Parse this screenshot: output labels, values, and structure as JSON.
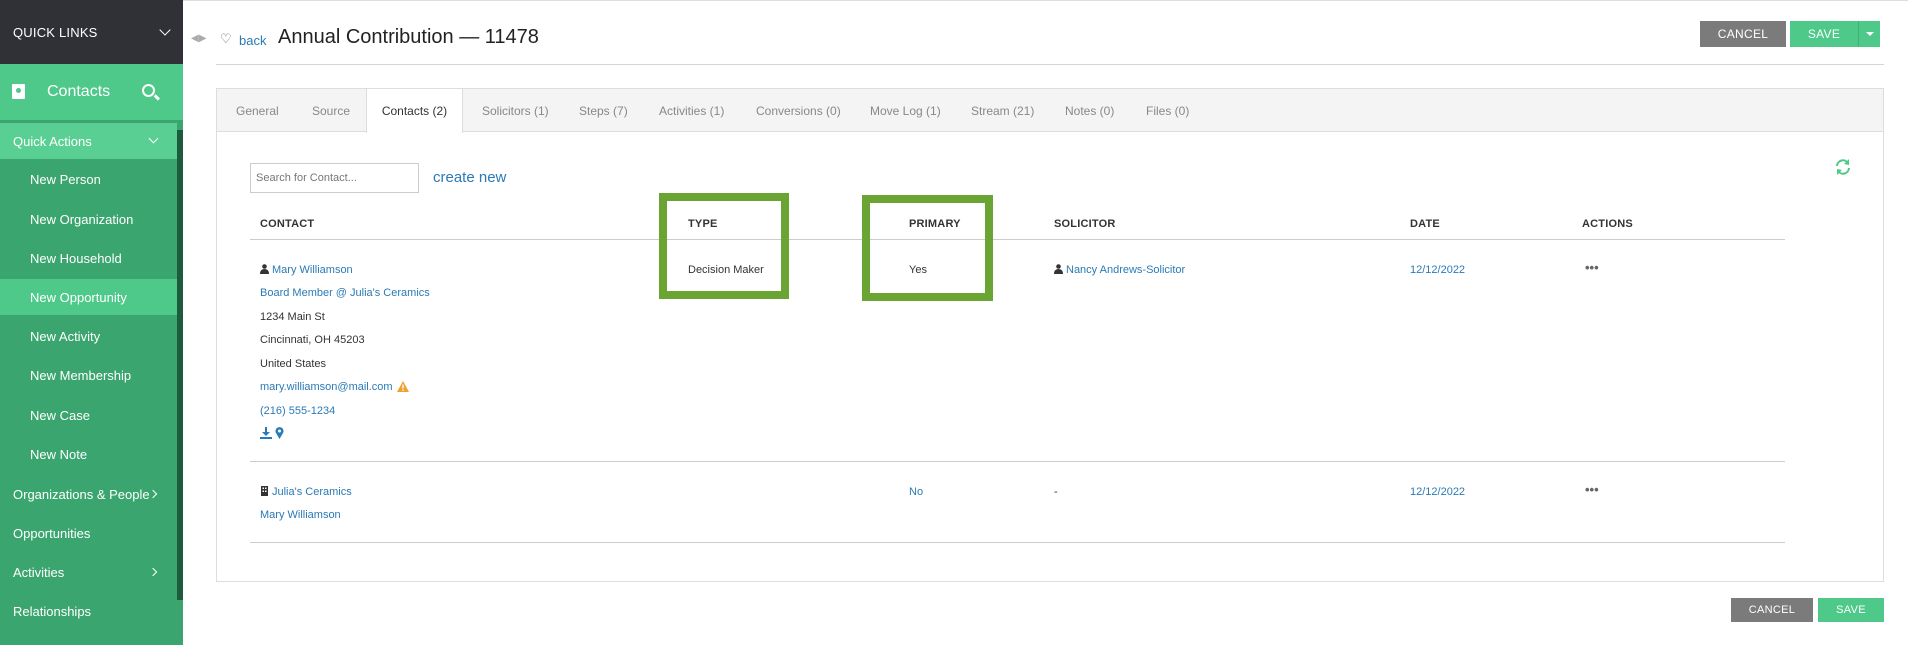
{
  "sidebar": {
    "quick_links": "QUICK LINKS",
    "module_title": "Contacts",
    "quick_actions": "Quick Actions",
    "sub_items": [
      "New Person",
      "New Organization",
      "New Household",
      "New Opportunity",
      "New Activity",
      "New Membership",
      "New Case",
      "New Note"
    ],
    "active_sub_item": "New Opportunity",
    "main_items": [
      "Organizations & People",
      "Opportunities",
      "Activities",
      "Relationships"
    ]
  },
  "header": {
    "back_label": "back",
    "title": "Annual Contribution — 11478",
    "cancel_label": "CANCEL",
    "save_label": "SAVE"
  },
  "tabs": [
    "General",
    "Source",
    "Contacts (2)",
    "Solicitors (1)",
    "Steps (7)",
    "Activities (1)",
    "Conversions (0)",
    "Move Log (1)",
    "Stream (21)",
    "Notes (0)",
    "Files (0)"
  ],
  "active_tab": "Contacts (2)",
  "contacts": {
    "search_placeholder": "Search for Contact...",
    "create_new": "create new",
    "columns": {
      "contact": "CONTACT",
      "type": "TYPE",
      "primary": "PRIMARY",
      "solicitor": "SOLICITOR",
      "date": "DATE",
      "actions": "ACTIONS"
    },
    "rows": [
      {
        "name": "Mary Williamson",
        "role": "Board Member @ Julia's Ceramics",
        "address1": "1234 Main St",
        "address2": "Cincinnati, OH 45203",
        "country": "United States",
        "email": "mary.williamson@mail.com",
        "phone": "(216) 555-1234",
        "type": "Decision Maker",
        "primary": "Yes",
        "solicitor": "Nancy Andrews-Solicitor",
        "date": "12/12/2022",
        "actions": "•••"
      },
      {
        "name": "Julia's Ceramics",
        "sub": "Mary Williamson",
        "type": "",
        "primary": "No",
        "solicitor": "-",
        "date": "12/12/2022",
        "actions": "•••"
      }
    ]
  },
  "footer": {
    "cancel_label": "CANCEL",
    "save_label": "SAVE"
  },
  "colors": {
    "sidebar_green": "#3aa56e",
    "accent_green": "#4ec98a",
    "highlight_green": "#6aa534",
    "link_blue": "#2a7ab5",
    "cancel_gray": "#7b7b7b"
  }
}
